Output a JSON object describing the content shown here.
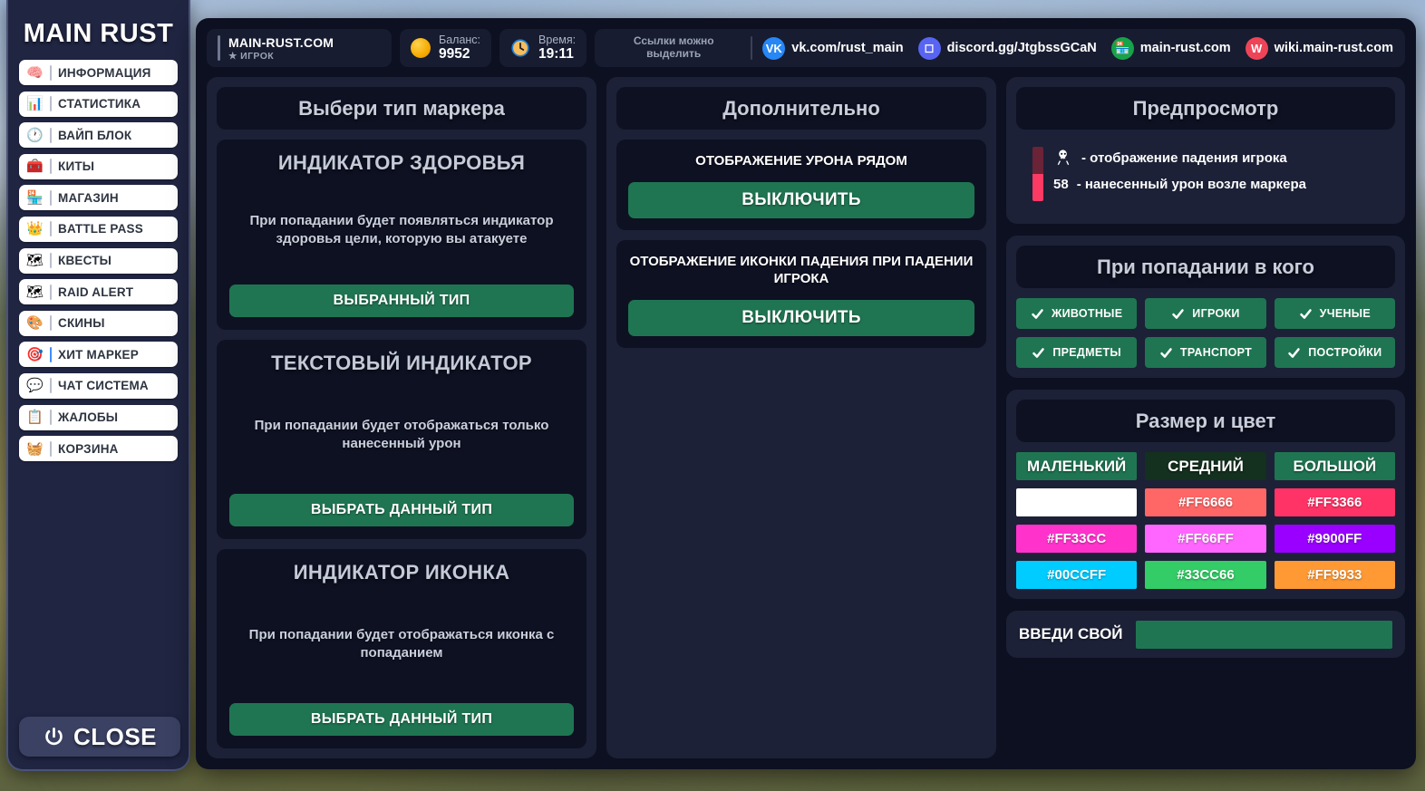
{
  "sidebar": {
    "brand": "MAIN RUST",
    "items": [
      {
        "label": "ИНФОРМАЦИЯ",
        "icon": "brain-icon",
        "glyph": "🧠",
        "active": false
      },
      {
        "label": "СТАТИСТИКА",
        "icon": "chart-search-icon",
        "glyph": "📊",
        "active": false
      },
      {
        "label": "ВАЙП БЛОК",
        "icon": "timer-icon",
        "glyph": "🕐",
        "active": false
      },
      {
        "label": "КИТЫ",
        "icon": "toolbox-icon",
        "glyph": "🧰",
        "active": false
      },
      {
        "label": "МАГАЗИН",
        "icon": "store-icon",
        "glyph": "🏪",
        "active": false
      },
      {
        "label": "BATTLE PASS",
        "icon": "crown-medal-icon",
        "glyph": "👑",
        "active": false
      },
      {
        "label": "КВЕСТЫ",
        "icon": "map-scroll-icon",
        "glyph": "🗺",
        "active": false
      },
      {
        "label": "RAID ALERT",
        "icon": "alert-map-icon",
        "glyph": "🗺",
        "active": false
      },
      {
        "label": "СКИНЫ",
        "icon": "palette-icon",
        "glyph": "🎨",
        "active": false
      },
      {
        "label": "ХИТ МАРКЕР",
        "icon": "crosshair-icon",
        "glyph": "🎯",
        "active": true
      },
      {
        "label": "ЧАТ СИСТЕМА",
        "icon": "chat-bubble-icon",
        "glyph": "💬",
        "active": false
      },
      {
        "label": "ЖАЛОБЫ",
        "icon": "report-icon",
        "glyph": "📋",
        "active": false
      },
      {
        "label": "КОРЗИНА",
        "icon": "basket-icon",
        "glyph": "🧺",
        "active": false
      }
    ],
    "close_label": "CLOSE"
  },
  "topbar": {
    "server_name": "MAIN-RUST.COM",
    "player_role": "★ ИГРОК",
    "balance_label": "Баланс:",
    "balance_value": "9952",
    "time_label": "Время:",
    "time_value": "19:11",
    "links_hint": "Ссылки можно выделить",
    "links": [
      {
        "text": "vk.com/rust_main",
        "icon": "vk-icon",
        "glyph": "VK",
        "color": "#2787f5"
      },
      {
        "text": "discord.gg/JtgbssGCaN",
        "icon": "discord-icon",
        "glyph": "◻",
        "color": "#5865f2"
      },
      {
        "text": "main-rust.com",
        "icon": "store-icon",
        "glyph": "🏪",
        "color": "#16a34a"
      },
      {
        "text": "wiki.main-rust.com",
        "icon": "wiki-icon",
        "glyph": "W",
        "color": "#ef4458"
      }
    ]
  },
  "marker_types": {
    "title": "Выбери тип маркера",
    "cards": [
      {
        "title": "ИНДИКАТОР ЗДОРОВЬЯ",
        "desc": "При попадании будет появляться индикатор здоровья цели, которую вы атакуете",
        "button": "ВЫБРАННЫЙ ТИП",
        "selected": true
      },
      {
        "title": "ТЕКСТОВЫЙ ИНДИКАТОР",
        "desc": "При попадании будет отображаться только нанесенный урон",
        "button": "ВЫБРАТЬ ДАННЫЙ ТИП",
        "selected": false
      },
      {
        "title": "ИНДИКАТОР ИКОНКА",
        "desc": "При попадании будет отображаться иконка с попаданием",
        "button": "ВЫБРАТЬ ДАННЫЙ ТИП",
        "selected": false
      }
    ]
  },
  "additional": {
    "title": "Дополнительно",
    "options": [
      {
        "label": "ОТОБРАЖЕНИЕ УРОНА РЯДОМ",
        "button": "ВЫКЛЮЧИТЬ"
      },
      {
        "label": "ОТОБРАЖЕНИЕ ИКОНКИ ПАДЕНИЯ ПРИ ПАДЕНИИ ИГРОКА",
        "button": "ВЫКЛЮЧИТЬ"
      }
    ]
  },
  "preview": {
    "title": "Предпросмотр",
    "line_fall": "- отображение падения игрока",
    "damage_value": "58",
    "line_damage": "- нанесенный урон возле маркера",
    "bar_top_color": "#6B2338",
    "bar_bottom_color": "#FC3A63"
  },
  "targets": {
    "title": "При попадании в кого",
    "items": [
      {
        "label": "ЖИВОТНЫЕ",
        "checked": true
      },
      {
        "label": "ИГРОКИ",
        "checked": true
      },
      {
        "label": "УЧЕНЫЕ",
        "checked": true
      },
      {
        "label": "ПРЕДМЕТЫ",
        "checked": true
      },
      {
        "label": "ТРАНСПОРТ",
        "checked": true
      },
      {
        "label": "ПОСТРОЙКИ",
        "checked": true
      }
    ]
  },
  "size_color": {
    "title": "Размер и цвет",
    "sizes": [
      {
        "label": "МАЛЕНЬКИЙ",
        "selected": false,
        "bg": "#1F7552"
      },
      {
        "label": "СРЕДНИЙ",
        "selected": true,
        "bg": "#14301F"
      },
      {
        "label": "БОЛЬШОЙ",
        "selected": false,
        "bg": "#1F7552"
      }
    ],
    "swatches": [
      {
        "label": "",
        "hex": "#FFFFFF",
        "text_color": "#FFFFFF"
      },
      {
        "label": "#FF6666",
        "hex": "#FF6666",
        "text_color": "#FFFFFF"
      },
      {
        "label": "#FF3366",
        "hex": "#FF3366",
        "text_color": "#FFFFFF"
      },
      {
        "label": "#FF33CC",
        "hex": "#FF33CC",
        "text_color": "#FFFFFF"
      },
      {
        "label": "#FF66FF",
        "hex": "#FF66FF",
        "text_color": "#FFFFFF"
      },
      {
        "label": "#9900FF",
        "hex": "#9900FF",
        "text_color": "#FFFFFF"
      },
      {
        "label": "#00CCFF",
        "hex": "#00CCFF",
        "text_color": "#FFFFFF"
      },
      {
        "label": "#33CC66",
        "hex": "#33CC66",
        "text_color": "#FFFFFF"
      },
      {
        "label": "#FF9933",
        "hex": "#FF9933",
        "text_color": "#FFFFFF"
      }
    ],
    "custom_label": "ВВЕДИ СВОЙ",
    "custom_value": "",
    "custom_placeholder": ""
  },
  "theme": {
    "accent_green": "#1F7552",
    "panel": "#1C2137",
    "card": "#0E1122",
    "window": "#0D1020",
    "sidebar": "#202542"
  }
}
